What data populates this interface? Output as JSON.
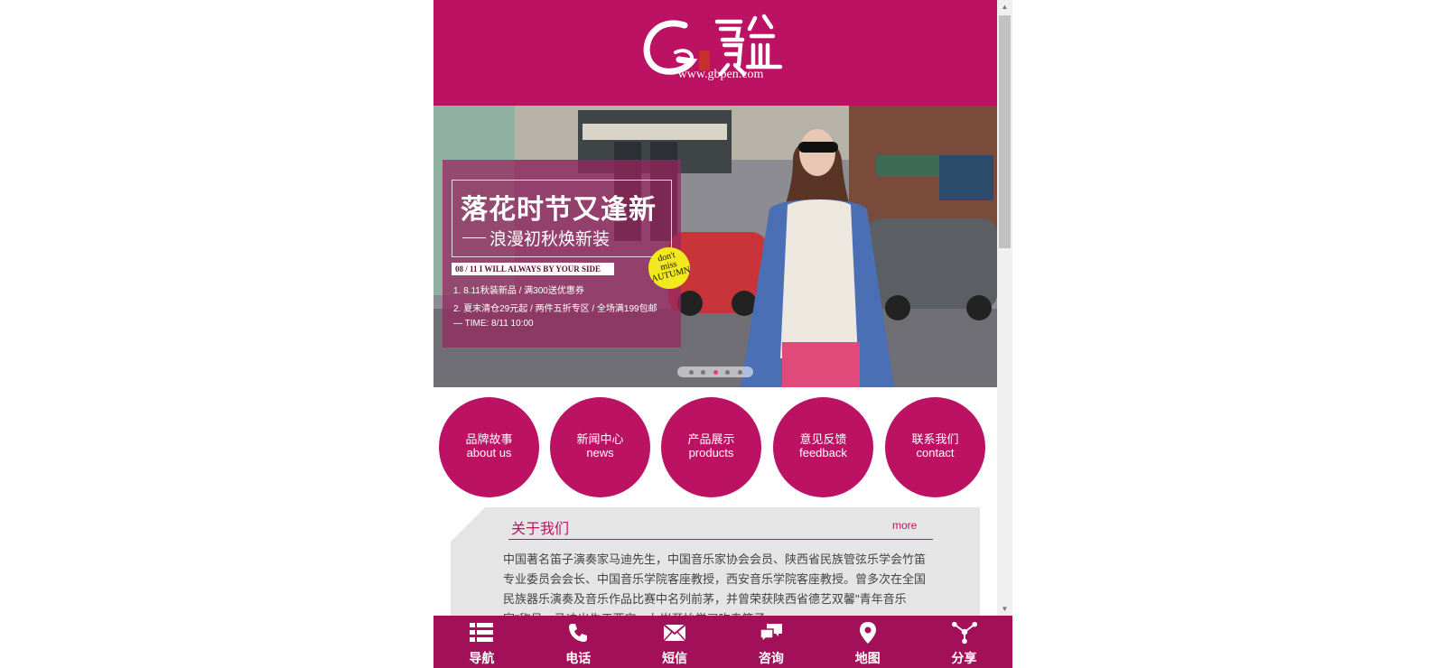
{
  "header": {
    "logo_url": "www.gbpen.com"
  },
  "banner": {
    "title": "落花时节又逢新",
    "subtitle": "浪漫初秋焕新装",
    "strip": "08 / 11   I WILL ALWAYS BY YOUR SIDE",
    "line1": "1. 8.11秋装新品 / 满300送优惠券",
    "line2": "2. 夏末清仓29元起 / 两件五折专区 / 全场满199包邮",
    "time": "— TIME: 8/11  10:00",
    "badge": [
      "don't",
      "miss",
      "AUTUMN"
    ],
    "dots": 5,
    "active_dot": 3
  },
  "nav": [
    {
      "cn": "品牌故事",
      "en": "about us"
    },
    {
      "cn": "新闻中心",
      "en": "news"
    },
    {
      "cn": "产品展示",
      "en": "products"
    },
    {
      "cn": "意见反馈",
      "en": "feedback"
    },
    {
      "cn": "联系我们",
      "en": "contact"
    }
  ],
  "about": {
    "title": "关于我们",
    "more": "more",
    "text": "中国著名笛子演奏家马迪先生，中国音乐家协会会员、陕西省民族管弦乐学会竹笛专业委员会会长、中国音乐学院客座教授，西安音乐学院客座教授。曾多次在全国民族器乐演奏及音乐作品比赛中名列前茅，并曾荣获陕西省德艺双馨\"青年音乐家\"称号。马迪出生于西安，九岁开始学习吹奏笛子。"
  },
  "bottom_bar": [
    {
      "label": "导航",
      "icon": "list-icon"
    },
    {
      "label": "电话",
      "icon": "phone-icon"
    },
    {
      "label": "短信",
      "icon": "envelope-icon"
    },
    {
      "label": "咨询",
      "icon": "chat-icon"
    },
    {
      "label": "地图",
      "icon": "map-pin-icon"
    },
    {
      "label": "分享",
      "icon": "share-icon"
    }
  ],
  "colors": {
    "brand": "#bb1264",
    "bottom_bar": "#a3105a",
    "badge": "#f2e81e",
    "active_dot": "#e83a83"
  }
}
